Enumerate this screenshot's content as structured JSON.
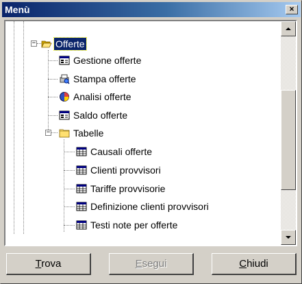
{
  "window": {
    "title": "Menù",
    "close_label": "×"
  },
  "tree": {
    "root": {
      "label": "Offerte",
      "expander": "−",
      "icon": "open-folder-icon",
      "selected": true
    },
    "items": [
      {
        "label": "Gestione offerte",
        "icon": "form-icon"
      },
      {
        "label": "Stampa offerte",
        "icon": "print-icon"
      },
      {
        "label": "Analisi offerte",
        "icon": "analysis-icon"
      },
      {
        "label": "Saldo offerte",
        "icon": "form-icon"
      }
    ],
    "folder": {
      "label": "Tabelle",
      "expander": "−",
      "icon": "folder-icon"
    },
    "table_items": [
      {
        "label": "Causali offerte",
        "icon": "table-icon"
      },
      {
        "label": "Clienti provvisori",
        "icon": "table-icon"
      },
      {
        "label": "Tariffe provvisorie",
        "icon": "table-icon"
      },
      {
        "label": "Definizione clienti provvisori",
        "icon": "table-icon"
      },
      {
        "label": "Testi note per offerte",
        "icon": "table-icon"
      }
    ]
  },
  "buttons": {
    "find": {
      "key": "T",
      "rest": "rova"
    },
    "run": {
      "key": "E",
      "rest": "segui",
      "disabled": true
    },
    "close": {
      "key": "C",
      "rest": "hiudi"
    }
  },
  "colors": {
    "titlebar_start": "#0a246a",
    "titlebar_end": "#a6caf0",
    "selection": "#0a246a",
    "face": "#d4d0c8"
  }
}
